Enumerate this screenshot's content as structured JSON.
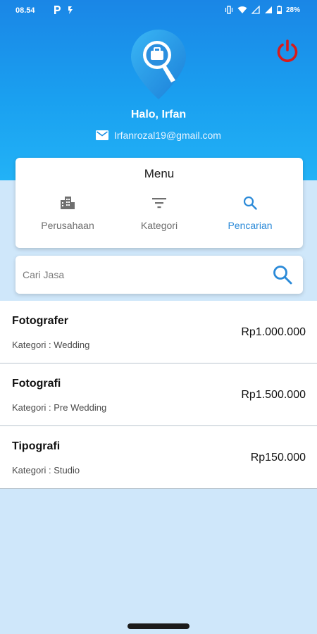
{
  "status_bar": {
    "time": "08.54",
    "battery": "28%"
  },
  "profile": {
    "greeting": "Halo, Irfan",
    "email": "Irfanrozal19@gmail.com"
  },
  "menu": {
    "title": "Menu",
    "items": [
      {
        "label": "Perusahaan",
        "icon": "building-icon",
        "active": false
      },
      {
        "label": "Kategori",
        "icon": "filter-icon",
        "active": false
      },
      {
        "label": "Pencarian",
        "icon": "search-icon",
        "active": true
      }
    ]
  },
  "search": {
    "placeholder": "Cari Jasa",
    "value": ""
  },
  "services": [
    {
      "title": "Fotografer",
      "category": "Kategori : Wedding",
      "price": "Rp1.000.000"
    },
    {
      "title": "Fotografi",
      "category": "Kategori : Pre Wedding",
      "price": "Rp1.500.000"
    },
    {
      "title": "Tipografi",
      "category": "Kategori : Studio",
      "price": "Rp150.000"
    }
  ],
  "colors": {
    "header_top": "#1a86e6",
    "header_bottom": "#22b2f6",
    "accent": "#2b8ad8",
    "power": "#d81b1b",
    "background": "#cfe7fa"
  }
}
